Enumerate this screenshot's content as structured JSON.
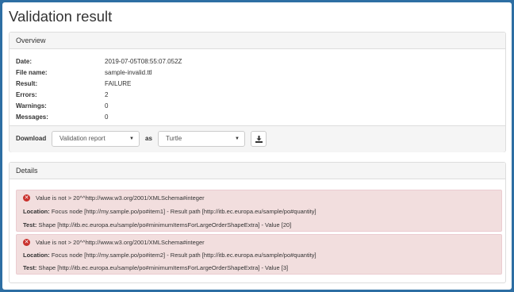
{
  "page": {
    "title": "Validation result"
  },
  "overview": {
    "heading": "Overview",
    "rows": [
      {
        "key": "Date:",
        "value": "2019-07-05T08:55:07.052Z"
      },
      {
        "key": "File name:",
        "value": "sample-invalid.ttl"
      },
      {
        "key": "Result:",
        "value": "FAILURE"
      },
      {
        "key": "Errors:",
        "value": "2"
      },
      {
        "key": "Warnings:",
        "value": "0"
      },
      {
        "key": "Messages:",
        "value": "0"
      }
    ],
    "download": {
      "label": "Download",
      "format_selected": "Validation report",
      "as_label": "as",
      "type_selected": "Turtle",
      "icon": "download-icon"
    }
  },
  "details": {
    "heading": "Details",
    "items": [
      {
        "message": "Value is not > 20^^http://www.w3.org/2001/XMLSchema#integer",
        "location_label": "Location:",
        "location": "Focus node [http://my.sample.po/po#item1] - Result path [http://itb.ec.europa.eu/sample/po#quantity]",
        "test_label": "Test:",
        "test": "Shape [http://itb.ec.europa.eu/sample/po#minimumItemsForLargeOrderShapeExtra] - Value [20]"
      },
      {
        "message": "Value is not > 20^^http://www.w3.org/2001/XMLSchema#integer",
        "location_label": "Location:",
        "location": "Focus node [http://my.sample.po/po#item2] - Result path [http://itb.ec.europa.eu/sample/po#quantity]",
        "test_label": "Test:",
        "test": "Shape [http://itb.ec.europa.eu/sample/po#minimumItemsForLargeOrderShapeExtra] - Value [3]"
      }
    ]
  },
  "colors": {
    "error_bg": "#f2dede",
    "error_icon": "#c9302c",
    "frame": "#2d6ea3"
  }
}
